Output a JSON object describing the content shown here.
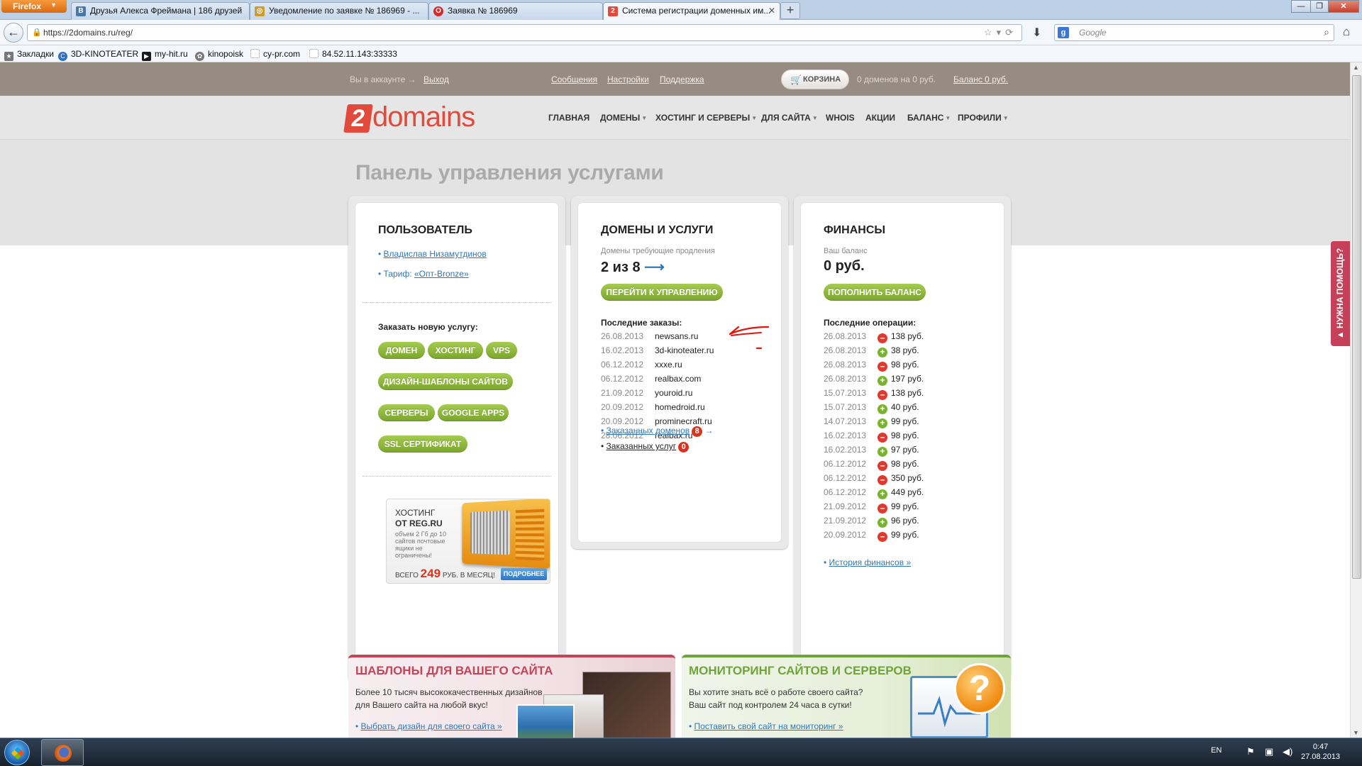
{
  "browser": {
    "menu_label": "Firefox",
    "tabs": [
      {
        "label": "Друзья Алекса Фреймана | 186 друзей",
        "icon": "vk-icon",
        "color": "#4a76a8",
        "glyph": "В"
      },
      {
        "label": "Уведомление по заявке № 186969 - ...",
        "icon": "chrome-icon",
        "color": "#cc9b2b",
        "glyph": "◎"
      },
      {
        "label": "Заявка № 186969",
        "icon": "opera-icon",
        "color": "#d42a2a",
        "glyph": "О"
      },
      {
        "label": "Система регистрации доменных им...",
        "icon": "2domains-icon",
        "color": "#e24a3b",
        "glyph": "2"
      }
    ],
    "new_tab": "+",
    "url": "https://2domains.ru/reg/",
    "search_placeholder": "Google",
    "bookmarks": [
      {
        "label": "Закладки",
        "icon": "bookmarks-star-icon",
        "color": "#666"
      },
      {
        "label": "3D-KINOTEATER",
        "icon": "kinoteater-icon",
        "color": "#2a6ec8"
      },
      {
        "label": "my-hit.ru",
        "icon": "myhit-icon",
        "color": "#1a1a1a"
      },
      {
        "label": "kinopoisk",
        "icon": "kinopoisk-icon",
        "color": "#777"
      },
      {
        "label": "cy-pr.com",
        "icon": "page-icon",
        "color": "#bbb"
      },
      {
        "label": "84.52.11.143:33333",
        "icon": "page-icon",
        "color": "#bbb"
      }
    ]
  },
  "topbar": {
    "account_text": "Вы в аккаунте →",
    "logout": "Выход",
    "messages": "Сообщения",
    "settings": "Настройки",
    "support": "Поддержка",
    "cart": "КОРЗИНА",
    "cart_info": "0 доменов на 0 руб.",
    "balance": "Баланс 0 руб."
  },
  "header": {
    "logo_num": "2",
    "logo_word": "domains",
    "nav": [
      {
        "label": "ГЛАВНАЯ",
        "dropdown": false
      },
      {
        "label": "ДОМЕНЫ",
        "dropdown": true
      },
      {
        "label": "ХОСТИНГ И СЕРВЕРЫ",
        "dropdown": true
      },
      {
        "label": "ДЛЯ САЙТА",
        "dropdown": true
      },
      {
        "label": "WHOIS",
        "dropdown": false
      },
      {
        "label": "АКЦИИ",
        "dropdown": false
      },
      {
        "label": "БАЛАНС",
        "dropdown": true
      },
      {
        "label": "ПРОФИЛИ",
        "dropdown": true
      }
    ]
  },
  "page_title": "Панель управления услугами",
  "user": {
    "title": "ПОЛЬЗОВАТЕЛЬ",
    "name": "Владислав Низамутдинов",
    "tariff_label": "Тариф:",
    "tariff_value": "«Опт-Bronze»",
    "order_title": "Заказать новую услугу:",
    "buttons": [
      "ДОМЕН",
      "ХОСТИНГ",
      "VPS",
      "ДИЗАЙН-ШАБЛОНЫ САЙТОВ",
      "СЕРВЕРЫ",
      "GOOGLE APPS",
      "SSL СЕРТИФИКАТ"
    ],
    "ad": {
      "line1": "ХОСТИНГ",
      "line2": "ОТ REG.RU",
      "desc": "объем 2 Гб до 10 сайтов почтовые ящики не ограничены!",
      "price_pre": "ВСЕГО",
      "price": "249",
      "price_post": "РУБ. В МЕСЯЦ!",
      "more": "ПОДРОБНЕЕ"
    }
  },
  "domains": {
    "title": "ДОМЕНЫ И УСЛУГИ",
    "renew_label": "Домены требующие продления",
    "renew_value": "2 из 8",
    "manage_button": "ПЕРЕЙТИ К УПРАВЛЕНИЮ",
    "orders_title": "Последние заказы:",
    "orders": [
      {
        "date": "26.08.2013",
        "name": "newsans.ru"
      },
      {
        "date": "16.02.2013",
        "name": "3d-kinoteater.ru"
      },
      {
        "date": "06.12.2012",
        "name": "xxxe.ru"
      },
      {
        "date": "06.12.2012",
        "name": "realbax.com"
      },
      {
        "date": "21.09.2012",
        "name": "youroid.ru"
      },
      {
        "date": "20.09.2012",
        "name": "homedroid.ru"
      },
      {
        "date": "20.09.2012",
        "name": "prominecraft.ru"
      },
      {
        "date": "28.06.2012",
        "name": "realbax.ru"
      }
    ],
    "ordered_domains": "Заказанных доменов",
    "ordered_domains_count": "8",
    "ordered_services": "Заказанных услуг",
    "ordered_services_count": "0"
  },
  "finance": {
    "title": "ФИНАНСЫ",
    "balance_label": "Ваш баланс",
    "balance_value": "0 руб.",
    "topup_button": "ПОПОЛНИТЬ БАЛАНС",
    "ops_title": "Последние операции:",
    "ops": [
      {
        "date": "26.08.2013",
        "sign": "minus",
        "amount": "138 руб."
      },
      {
        "date": "26.08.2013",
        "sign": "plus",
        "amount": "38 руб."
      },
      {
        "date": "26.08.2013",
        "sign": "minus",
        "amount": "98 руб."
      },
      {
        "date": "26.08.2013",
        "sign": "plus",
        "amount": "197 руб."
      },
      {
        "date": "15.07.2013",
        "sign": "minus",
        "amount": "138 руб."
      },
      {
        "date": "15.07.2013",
        "sign": "plus",
        "amount": "40 руб."
      },
      {
        "date": "14.07.2013",
        "sign": "plus",
        "amount": "99 руб."
      },
      {
        "date": "16.02.2013",
        "sign": "minus",
        "amount": "98 руб."
      },
      {
        "date": "16.02.2013",
        "sign": "plus",
        "amount": "97 руб."
      },
      {
        "date": "06.12.2012",
        "sign": "minus",
        "amount": "98 руб."
      },
      {
        "date": "06.12.2012",
        "sign": "minus",
        "amount": "350 руб."
      },
      {
        "date": "06.12.2012",
        "sign": "plus",
        "amount": "449 руб."
      },
      {
        "date": "21.09.2012",
        "sign": "minus",
        "amount": "99 руб."
      },
      {
        "date": "21.09.2012",
        "sign": "plus",
        "amount": "96 руб."
      },
      {
        "date": "20.09.2012",
        "sign": "minus",
        "amount": "99 руб."
      }
    ],
    "history_link": "История финансов »"
  },
  "banners": {
    "templates": {
      "title": "ШАБЛОНЫ ДЛЯ ВАШЕГО САЙТА",
      "text1": "Более 10 тысяч высококачественных дизайнов",
      "text2": "для Вашего сайта на любой вкус!",
      "link": "Выбрать дизайн для своего сайта »",
      "color": "#c4455a"
    },
    "monitoring": {
      "title": "МОНИТОРИНГ САЙТОВ И СЕРВЕРОВ",
      "text1": "Вы хотите знать всё о работе своего сайта?",
      "text2": "Ваш сайт под контролем 24 часа в сутки!",
      "link": "Поставить свой сайт на мониторинг »",
      "color": "#6fa43a"
    }
  },
  "help_tab": "▲ НУЖНА ПОМОЩЬ?",
  "taskbar": {
    "lang": "EN",
    "time": "0:47",
    "date": "27.08.2013"
  }
}
